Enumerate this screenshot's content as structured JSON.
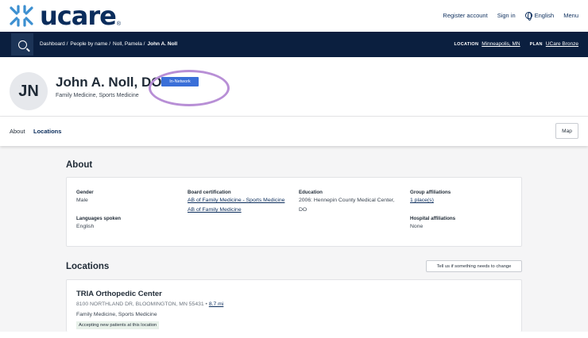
{
  "brand": {
    "name": "ucare",
    "color": "#0b2d5c"
  },
  "top_links": {
    "register": "Register account",
    "sign_in": "Sign in",
    "language": "English",
    "menu": "Menu"
  },
  "nav": {
    "breadcrumbs": [
      "Dashboard /",
      "People by name /",
      "Noll, Pamela /",
      "John A. Noll"
    ],
    "location_label": "LOCATION",
    "location_value": "Minneapolis, MN",
    "plan_label": "PLAN",
    "plan_value": "UCare Bronze"
  },
  "provider": {
    "initials": "JN",
    "name": "John A. Noll, DO",
    "badge": "In-Network",
    "specialty": "Family Medicine, Sports Medicine"
  },
  "tabs": {
    "about": "About",
    "locations": "Locations",
    "map": "Map"
  },
  "about": {
    "title": "About",
    "gender_label": "Gender",
    "gender_value": "Male",
    "languages_label": "Languages spoken",
    "languages_value": "English",
    "board_label": "Board certification",
    "board_values": [
      "AB of Family Medicine - Sports Medicine",
      "AB of Family Medicine"
    ],
    "education_label": "Education",
    "education_value": "2006: Hennepin County Medical Center, DO",
    "group_label": "Group affiliations",
    "group_value": "1 place(s)",
    "hospital_label": "Hospital affiliations",
    "hospital_value": "None"
  },
  "locations": {
    "title": "Locations",
    "change_button": "Tell us if something needs to change",
    "items": [
      {
        "name": "TRIA Orthopedic Center",
        "address": "8100 NORTHLAND DR, BLOOMINGTON, MN 55431 •",
        "distance": "8.7 mi",
        "specialty": "Family Medicine, Sports Medicine",
        "status": "Accepting new patients at this location"
      }
    ]
  }
}
